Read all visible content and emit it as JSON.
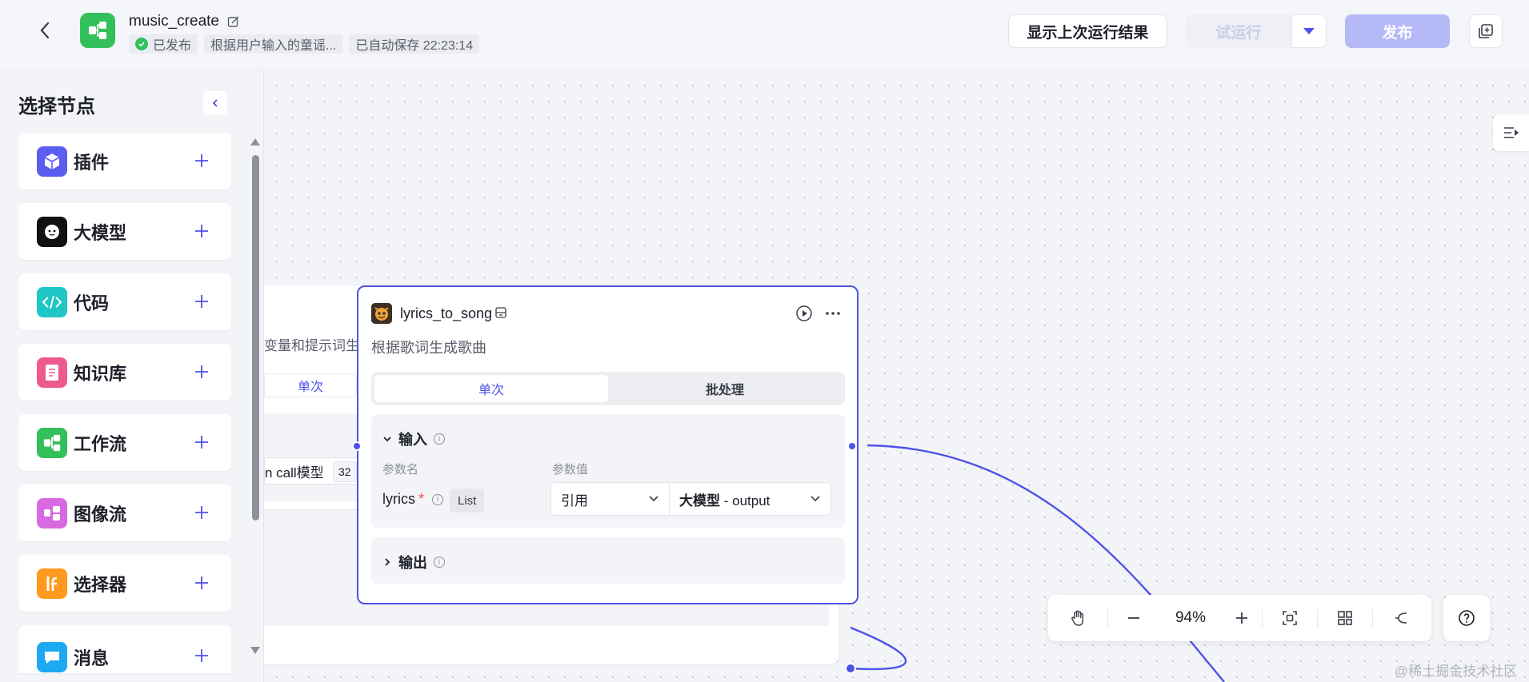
{
  "header": {
    "title": "music_create",
    "status_published": "已发布",
    "description_chip": "根据用户输入的童谣...",
    "autosave_chip": "已自动保存 22:23:14",
    "show_last_result": "显示上次运行结果",
    "trial_run": "试运行",
    "publish": "发布"
  },
  "sidebar": {
    "title": "选择节点",
    "items": [
      {
        "label": "插件",
        "icon": "cube-icon",
        "color": "#5b5cf0"
      },
      {
        "label": "大模型",
        "icon": "llm-face-icon",
        "color": "#111111"
      },
      {
        "label": "代码",
        "icon": "code-icon",
        "color": "#1fc6c6"
      },
      {
        "label": "知识库",
        "icon": "knowledge-icon",
        "color": "#ee5a8f"
      },
      {
        "label": "工作流",
        "icon": "workflow-icon",
        "color": "#33c05a"
      },
      {
        "label": "图像流",
        "icon": "imageflow-icon",
        "color": "#d969e0"
      },
      {
        "label": "选择器",
        "icon": "if-icon",
        "color": "#ff9a1f"
      },
      {
        "label": "消息",
        "icon": "message-icon",
        "color": "#1da8f2"
      }
    ]
  },
  "back_node": {
    "desc_fragment": "变量和提示词生",
    "tab_single": "单次",
    "model_fragment": "n call模型",
    "num_fragment": "32"
  },
  "node": {
    "title": "lyrics_to_song",
    "description": "根据歌词生成歌曲",
    "tab_single": "单次",
    "tab_batch": "批处理",
    "input_section": "输入",
    "col_param_name": "参数名",
    "col_param_value": "参数值",
    "param": {
      "name": "lyrics",
      "required_mark": "*",
      "type": "List",
      "ref_mode": "引用",
      "source_node": "大模型",
      "source_sep": " - ",
      "source_field": "output"
    },
    "output_section": "输出"
  },
  "zoom": {
    "level": "94%"
  },
  "watermark": "@稀土掘金技术社区",
  "colors": {
    "accent": "#4d53e8",
    "publish_disabled": "#b5b9f5",
    "published_green": "#33c05a"
  }
}
